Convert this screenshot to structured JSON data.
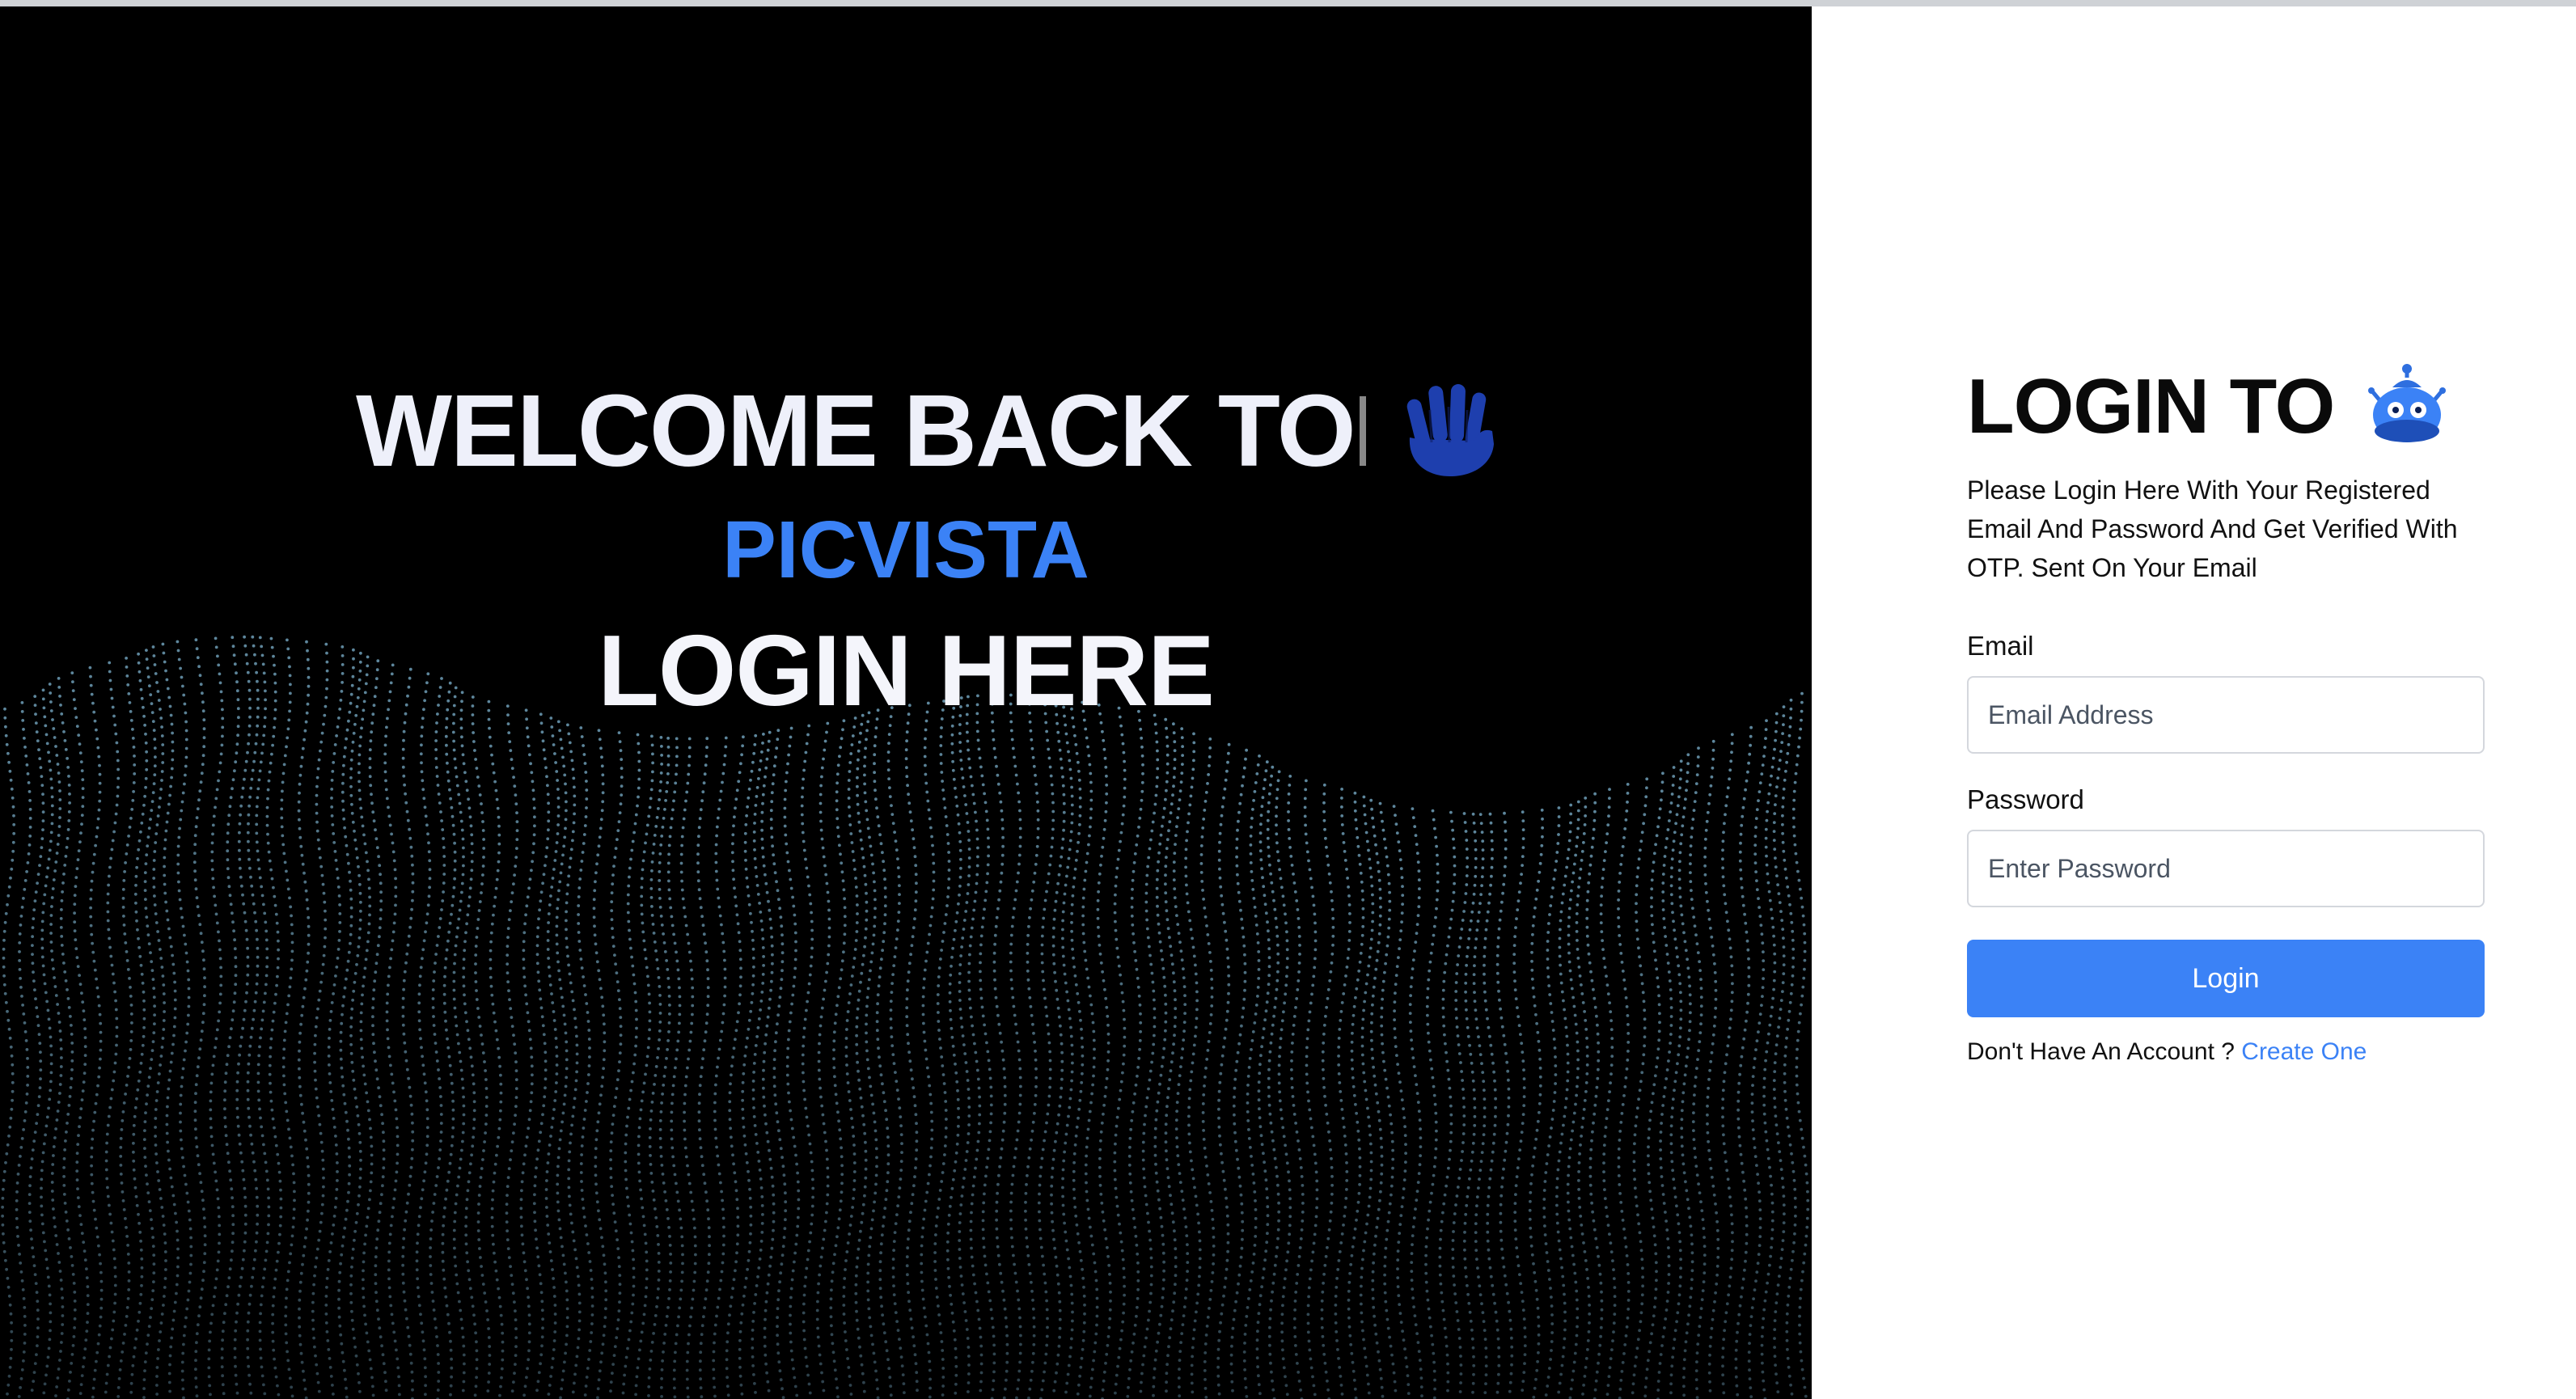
{
  "hero": {
    "welcome_text": "WELCOME BACK TO",
    "brand_name": "PICVISTA",
    "subtitle": "LOGIN HERE",
    "hand_icon": "waving-hand-icon",
    "background_color": "#000000",
    "wave_color": "#6f9fb8"
  },
  "form": {
    "title": "LOGIN TO",
    "title_icon": "robot-mascot-icon",
    "description": "Please Login Here With Your Registered Email And Password And Get Verified With OTP. Sent On Your Email",
    "email": {
      "label": "Email",
      "placeholder": "Email Address",
      "value": ""
    },
    "password": {
      "label": "Password",
      "placeholder": "Enter Password",
      "value": ""
    },
    "submit_label": "Login",
    "signup_prompt": "Don't Have An Account ?",
    "signup_link": "Create One"
  },
  "colors": {
    "accent": "#3b82f6",
    "panel_background": "#ffffff"
  }
}
